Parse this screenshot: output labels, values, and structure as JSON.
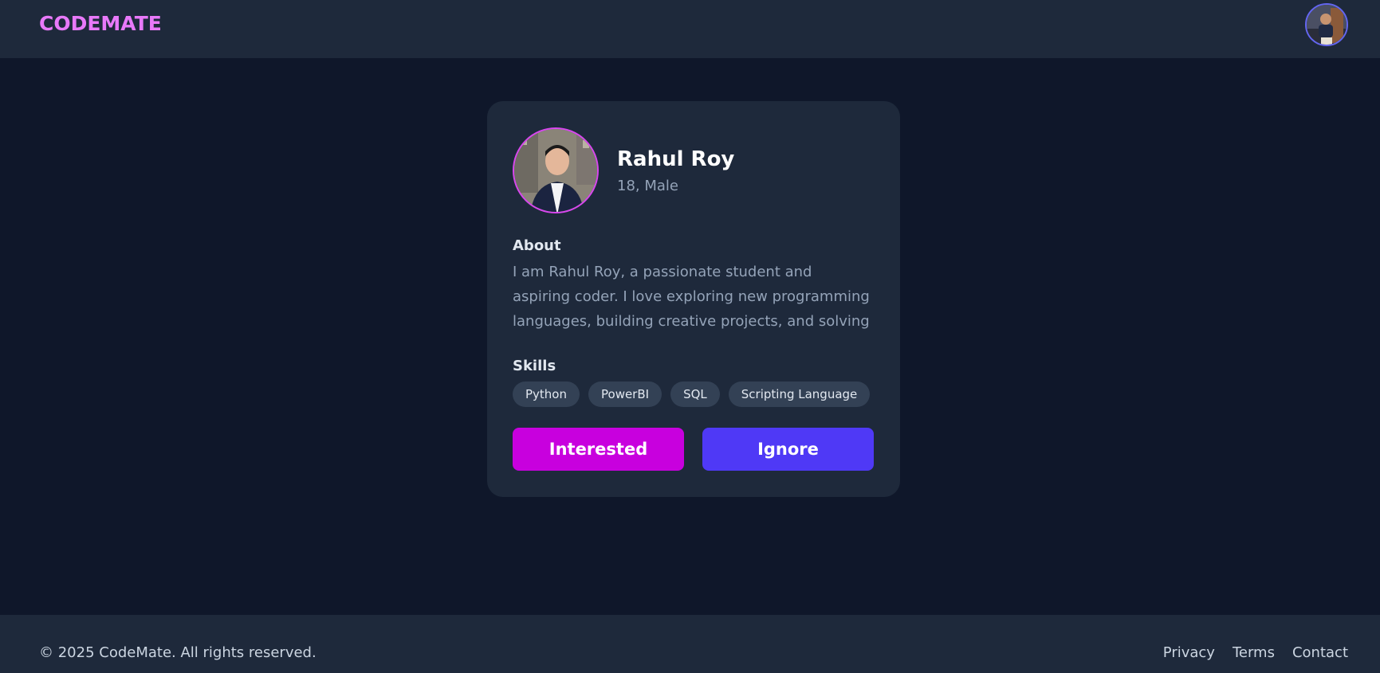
{
  "header": {
    "brand": "CODEMATE",
    "avatar_icon": "user-avatar"
  },
  "profile": {
    "name": "Rahul Roy",
    "meta": "18, Male",
    "photo_icon": "profile-photo",
    "about_title": "About",
    "about_text": "I am Rahul Roy, a passionate student and aspiring coder. I love exploring new programming languages, building creative projects, and solving challenging...",
    "skills_title": "Skills",
    "skills": [
      "Python",
      "PowerBI",
      "SQL",
      "Scripting Language"
    ],
    "interested_label": "Interested",
    "ignore_label": "Ignore"
  },
  "footer": {
    "copyright": "© 2025 CodeMate. All rights reserved.",
    "links": [
      "Privacy",
      "Terms",
      "Contact"
    ]
  },
  "colors": {
    "background": "#0f172a",
    "surface": "#1e293b",
    "brand": "#e879f9",
    "interested": "#c800de",
    "ignore": "#4f39f6",
    "chip": "#334155"
  }
}
